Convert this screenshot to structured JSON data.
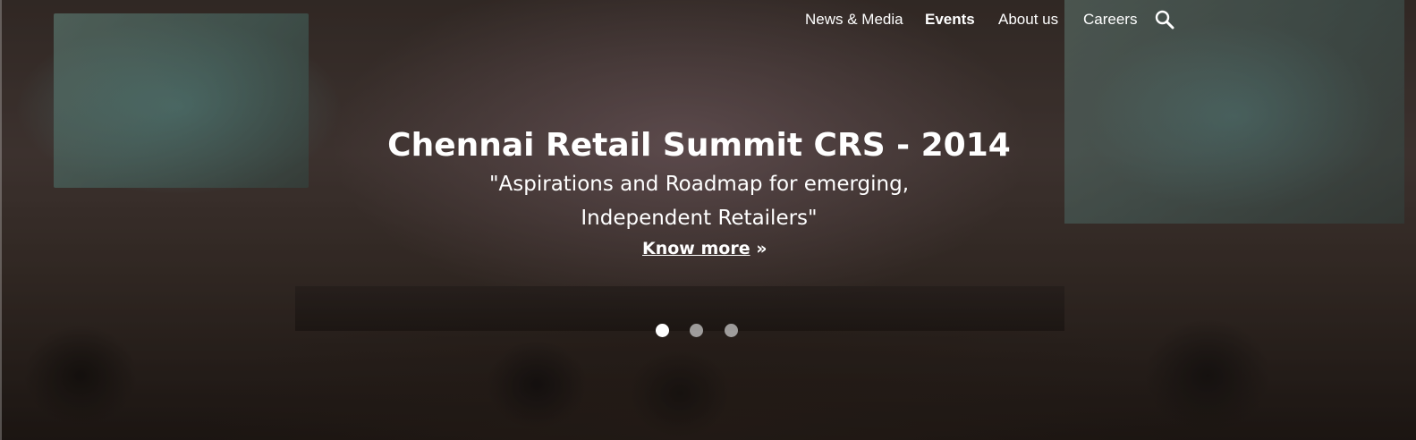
{
  "nav": {
    "items": [
      {
        "label": "News & Media",
        "active": false
      },
      {
        "label": "Events",
        "active": true
      },
      {
        "label": "About us",
        "active": false
      },
      {
        "label": "Careers",
        "active": false
      }
    ],
    "search_icon": "search-icon"
  },
  "hero": {
    "title": "Chennai Retail Summit CRS - 2014",
    "subtitle_line1": "\"Aspirations and Roadmap for emerging,",
    "subtitle_line2": "Independent Retailers\"",
    "link_label": "Know more",
    "link_suffix": "»"
  },
  "carousel": {
    "slide_count": 3,
    "active_index": 0
  }
}
